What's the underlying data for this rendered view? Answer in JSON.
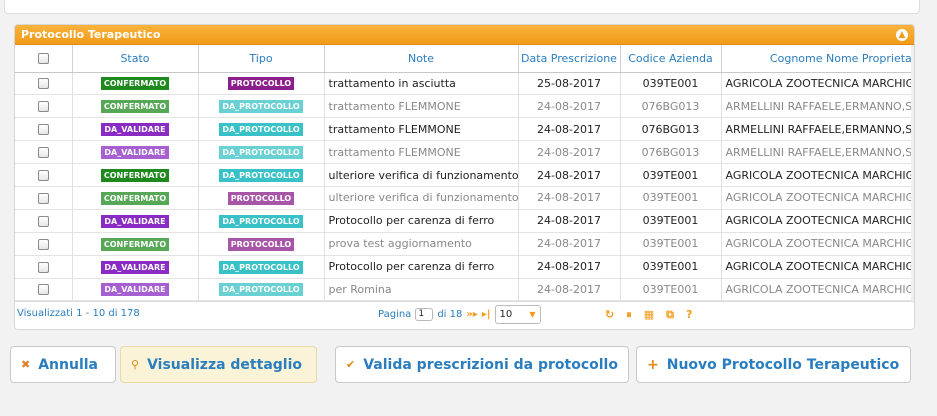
{
  "panel": {
    "title": "Protocollo Terapeutico",
    "collapse_icon": "chevron-up-icon"
  },
  "columns": [
    "",
    "Stato",
    "Tipo",
    "Note",
    "Data Prescrizione",
    "Codice Azienda",
    "Cognome Nome Proprietario"
  ],
  "colors": {
    "CONFERMATO": "#1e8a1e",
    "DA_VALIDARE": "#8a2bc4",
    "PROTOCOLLO": "#8a1e8a",
    "DA_PROTOCOLLO": "#38c1c6"
  },
  "rows": [
    {
      "stato": "CONFERMATO",
      "tipo": "PROTOCOLLO",
      "note": "trattamento in asciutta",
      "data": "25-08-2017",
      "codice": "039TE001",
      "proprietario": "AGRICOLA ZOOTECNICA MARCHIGIANA S"
    },
    {
      "stato": "CONFERMATO",
      "tipo": "DA_PROTOCOLLO",
      "note": "trattamento FLEMMONE",
      "data": "24-08-2017",
      "codice": "076BG013",
      "proprietario": "ARMELLINI RAFFAELE,ERMANNO,STEFAN"
    },
    {
      "stato": "DA_VALIDARE",
      "tipo": "DA_PROTOCOLLO",
      "note": "trattamento FLEMMONE",
      "data": "24-08-2017",
      "codice": "076BG013",
      "proprietario": "ARMELLINI RAFFAELE,ERMANNO,STEFAN"
    },
    {
      "stato": "DA_VALIDARE",
      "tipo": "DA_PROTOCOLLO",
      "note": "trattamento FLEMMONE",
      "data": "24-08-2017",
      "codice": "076BG013",
      "proprietario": "ARMELLINI RAFFAELE,ERMANNO,STEFAN"
    },
    {
      "stato": "CONFERMATO",
      "tipo": "DA_PROTOCOLLO",
      "note": "ulteriore verifica di funzionamento",
      "data": "24-08-2017",
      "codice": "039TE001",
      "proprietario": "AGRICOLA ZOOTECNICA MARCHIGIANA S"
    },
    {
      "stato": "CONFERMATO",
      "tipo": "PROTOCOLLO",
      "note": "ulteriore verifica di funzionamento",
      "data": "24-08-2017",
      "codice": "039TE001",
      "proprietario": "AGRICOLA ZOOTECNICA MARCHIGIANA S"
    },
    {
      "stato": "DA_VALIDARE",
      "tipo": "DA_PROTOCOLLO",
      "note": "Protocollo per carenza di ferro",
      "data": "24-08-2017",
      "codice": "039TE001",
      "proprietario": "AGRICOLA ZOOTECNICA MARCHIGIANA S"
    },
    {
      "stato": "CONFERMATO",
      "tipo": "PROTOCOLLO",
      "note": "prova test aggiornamento",
      "data": "24-08-2017",
      "codice": "039TE001",
      "proprietario": "AGRICOLA ZOOTECNICA MARCHIGIANA S"
    },
    {
      "stato": "DA_VALIDARE",
      "tipo": "DA_PROTOCOLLO",
      "note": "Protocollo per carenza di ferro",
      "data": "24-08-2017",
      "codice": "039TE001",
      "proprietario": "AGRICOLA ZOOTECNICA MARCHIGIANA S"
    },
    {
      "stato": "DA_VALIDARE",
      "tipo": "DA_PROTOCOLLO",
      "note": "per Romina",
      "data": "24-08-2017",
      "codice": "039TE001",
      "proprietario": "AGRICOLA ZOOTECNICA MARCHIGIANA S"
    }
  ],
  "footer": {
    "info": "Visualizzati 1 - 10 di 178",
    "page_label": "Pagina",
    "page_value": "1",
    "page_of": "di 18",
    "rows_per_page": "10"
  },
  "buttons": {
    "annulla": "Annulla",
    "dettaglio": "Visualizza dettaglio",
    "valida": "Valida prescrizioni da protocollo",
    "nuovo": "Nuovo Protocollo Terapeutico"
  }
}
